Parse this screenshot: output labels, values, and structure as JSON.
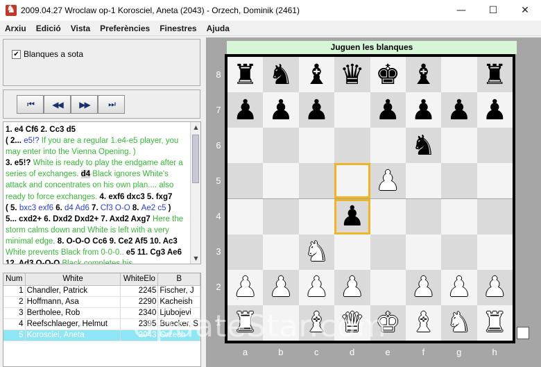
{
  "window": {
    "title": "2009.04.27 Wroclaw op-1 Korosciel, Aneta (2043) - Orzech, Dominik (2461)",
    "minimize": "—",
    "maximize": "☐",
    "close": "✕"
  },
  "menu": [
    "Arxiu",
    "Edició",
    "Vista",
    "Preferències",
    "Finestres",
    "Ajuda"
  ],
  "options": {
    "white_bottom_label": "Blanques a sota",
    "white_bottom_checked": true
  },
  "nav_buttons": [
    {
      "name": "first-move-button",
      "glyph": "⏮"
    },
    {
      "name": "prev-move-button",
      "glyph": "◀◀"
    },
    {
      "name": "next-move-button",
      "glyph": "▶▶"
    },
    {
      "name": "last-move-button",
      "glyph": "⏭"
    }
  ],
  "moves_text": [
    {
      "t": "1. e4 Cf6 2. Cc3 d5",
      "c": "mv"
    },
    {
      "br": true
    },
    {
      "t": "   ( 2... ",
      "c": "mv"
    },
    {
      "t": "e5!? ",
      "c": "vr"
    },
    {
      "t": "If you are a regular 1.e4-e5 player, you may enter into the Vienna Opening. )",
      "c": "cm"
    },
    {
      "br": true
    },
    {
      "t": "   3. e5!? ",
      "c": "mv"
    },
    {
      "t": "White is ready to play the endgame after a series of exchanges. ",
      "c": "cm"
    },
    {
      "t": "d4",
      "c": "hl"
    },
    {
      "t": " Black ignores White's attack and concentrates on his own plan.... also ready to force exchanges. ",
      "c": "cm"
    },
    {
      "t": "4. exf6 dxc3 5. fxg7",
      "c": "mv"
    },
    {
      "br": true
    },
    {
      "t": "   ( 5. ",
      "c": "mv"
    },
    {
      "t": "bxc3 exf6 ",
      "c": "vr"
    },
    {
      "t": "6. ",
      "c": "mv"
    },
    {
      "t": "d4 Ad6 ",
      "c": "vr"
    },
    {
      "t": "7. ",
      "c": "mv"
    },
    {
      "t": "Cf3 O-O ",
      "c": "vr"
    },
    {
      "t": "8. ",
      "c": "mv"
    },
    {
      "t": "Ae2 c5 ",
      "c": "vr"
    },
    {
      "t": ")",
      "c": "mv"
    },
    {
      "br": true
    },
    {
      "t": "   5... cxd2+ 6. Dxd2 Dxd2+ 7. Axd2 Axg7 ",
      "c": "mv"
    },
    {
      "t": "Here the storm calms down and White is left with a very minimal edge. ",
      "c": "cm"
    },
    {
      "t": "8. O-O-O Cc6 9. Ce2 Af5 10. Ac3 ",
      "c": "mv"
    },
    {
      "t": "White prevents Black from 0-0-0.. ",
      "c": "cm"
    },
    {
      "t": "e5 11. Cg3 Ae6 12. Ad3 O-O-O ",
      "c": "mv"
    },
    {
      "t": "Black completes his",
      "c": "cm"
    }
  ],
  "game_table": {
    "headers": [
      "Num",
      "White",
      "WhiteElo",
      "B"
    ],
    "rows": [
      [
        "1",
        "Chandler, Patrick",
        "2245",
        "Fischer, J"
      ],
      [
        "2",
        "Hoffmann, Asa",
        "2290",
        "Kacheish"
      ],
      [
        "3",
        "Bertholee, Rob",
        "2340",
        "Ljubojevi"
      ],
      [
        "4",
        "Reefschlaeger, Helmut",
        "2395",
        "Buecker, S"
      ],
      [
        "5",
        "Korosciel, Aneta",
        "2043",
        "Orzech"
      ]
    ],
    "selected_index": 4
  },
  "board": {
    "turn_label": "Juguen les blanques",
    "ranks": [
      "8",
      "7",
      "6",
      "5",
      "4",
      "3",
      "2",
      "1"
    ],
    "files": [
      "a",
      "b",
      "c",
      "d",
      "e",
      "f",
      "g",
      "h"
    ],
    "position": [
      [
        "r",
        "n",
        "b",
        "q",
        "k",
        "b",
        "",
        "r"
      ],
      [
        "p",
        "p",
        "p",
        "",
        "p",
        "p",
        "p",
        "p"
      ],
      [
        "",
        "",
        "",
        "",
        "",
        "n",
        "",
        ""
      ],
      [
        "",
        "",
        "",
        "",
        "P",
        "",
        "",
        ""
      ],
      [
        "",
        "",
        "",
        "p",
        "",
        "",
        "",
        ""
      ],
      [
        "",
        "",
        "N",
        "",
        "",
        "",
        "",
        ""
      ],
      [
        "P",
        "P",
        "P",
        "P",
        "",
        "P",
        "P",
        "P"
      ],
      [
        "R",
        "",
        "B",
        "Q",
        "K",
        "B",
        "N",
        "R"
      ]
    ],
    "highlighted": [
      "d5",
      "d4"
    ]
  },
  "watermark": "UpdateStar.com"
}
